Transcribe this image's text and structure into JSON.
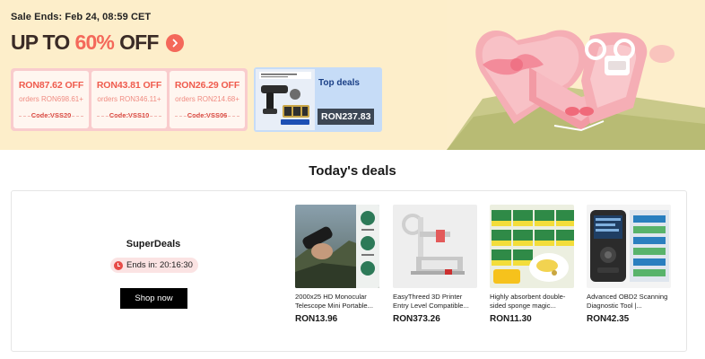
{
  "banner": {
    "sale_ends": "Sale Ends: Feb 24, 08:59 CET",
    "headline_prefix": "UP TO",
    "headline_percent": "60%",
    "headline_suffix": "OFF",
    "colors": {
      "background": "#fdeeca",
      "accent": "#f4685a"
    },
    "coupons": [
      {
        "amount": "RON87.62 OFF",
        "orders": "orders RON698.61+",
        "code": "Code:VSS20"
      },
      {
        "amount": "RON43.81 OFF",
        "orders": "orders RON346.11+",
        "code": "Code:VSS10"
      },
      {
        "amount": "RON26.29 OFF",
        "orders": "orders RON214.68+",
        "code": "Code:VSS06"
      }
    ],
    "top_deals": {
      "label": "Top deals",
      "price": "RON237.83"
    }
  },
  "deals": {
    "title": "Today's deals",
    "superdeals": {
      "title": "SuperDeals",
      "timer_prefix": "Ends in:",
      "timer_value": "20:16:30",
      "shop_now": "Shop now"
    },
    "products": [
      {
        "name": "2000x25 HD Monocular Telescope Mini Portable...",
        "price": "RON13.96"
      },
      {
        "name": "EasyThreed 3D Printer Entry Level Compatible...",
        "price": "RON373.26"
      },
      {
        "name": "Highly absorbent double-sided sponge magic...",
        "price": "RON11.30"
      },
      {
        "name": "Advanced OBD2 Scanning Diagnostic Tool |...",
        "price": "RON42.35"
      }
    ]
  }
}
